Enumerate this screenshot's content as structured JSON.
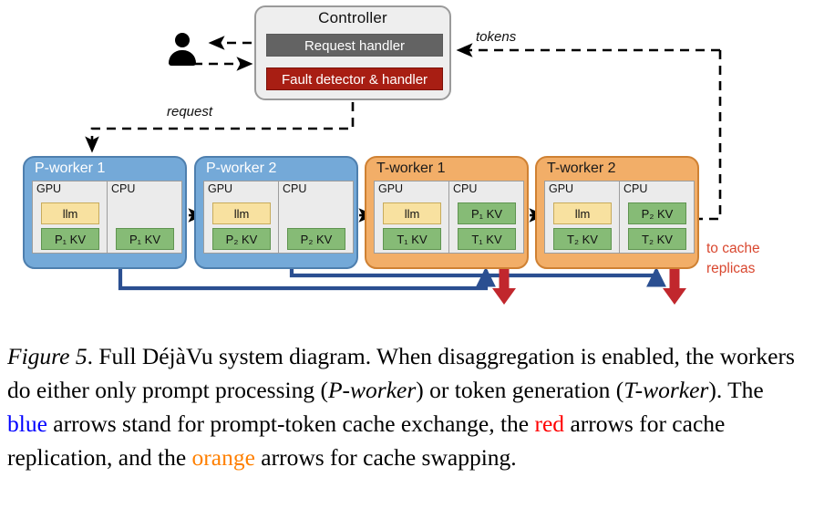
{
  "figure": {
    "controller": {
      "title": "Controller",
      "request_handler": "Request handler",
      "fault_handler": "Fault detector & handler"
    },
    "actor": {
      "icon": "user-icon"
    },
    "labels": {
      "request": "request",
      "tokens": "tokens",
      "to_cache_replicas": "to cache\nreplicas",
      "to_cache_replicas_line1": "to cache",
      "to_cache_replicas_line2": "replicas"
    },
    "workers": [
      {
        "id": "p-worker-1",
        "kind": "P-worker",
        "title": "P-worker 1",
        "color": "#74a9d8",
        "gpu": {
          "label": "GPU",
          "llm": "llm",
          "kv": "P₁ KV"
        },
        "cpu": {
          "label": "CPU",
          "kv": "P₁ KV"
        }
      },
      {
        "id": "p-worker-2",
        "kind": "P-worker",
        "title": "P-worker 2",
        "color": "#74a9d8",
        "gpu": {
          "label": "GPU",
          "llm": "llm",
          "kv": "P₂ KV"
        },
        "cpu": {
          "label": "CPU",
          "kv": "P₂ KV"
        }
      },
      {
        "id": "t-worker-1",
        "kind": "T-worker",
        "title": "T-worker 1",
        "color": "#f2ae68",
        "gpu": {
          "label": "GPU",
          "llm": "llm",
          "kv": "T₁ KV"
        },
        "cpu": {
          "label": "CPU",
          "kv_top": "P₁ KV",
          "kv": "T₁ KV"
        }
      },
      {
        "id": "t-worker-2",
        "kind": "T-worker",
        "title": "T-worker 2",
        "color": "#f2ae68",
        "gpu": {
          "label": "GPU",
          "llm": "llm",
          "kv": "T₂ KV"
        },
        "cpu": {
          "label": "CPU",
          "kv_top": "P₂ KV",
          "kv": "T₂ KV"
        }
      }
    ],
    "arrow_colors": {
      "prompt_token_exchange": "#2b4f91",
      "cache_replication": "#c1272d",
      "cache_swapping": "#f0a81e",
      "control_flow": "#000000"
    }
  },
  "caption": {
    "figure_label": "Figure 5",
    "text_1": ". Full DéjàVu system diagram.  When disaggregation is enabled, the workers do either only prompt processing (",
    "em_1": "P-worker",
    "text_2": ") or token generation (",
    "em_2": "T-worker",
    "text_3": "). The ",
    "blue": "blue",
    "text_4": " arrows stand for prompt-token cache exchange, the ",
    "red": "red",
    "text_5": " arrows for cache replication, and the ",
    "orange": "orange",
    "text_6": " arrows for cache swapping."
  }
}
